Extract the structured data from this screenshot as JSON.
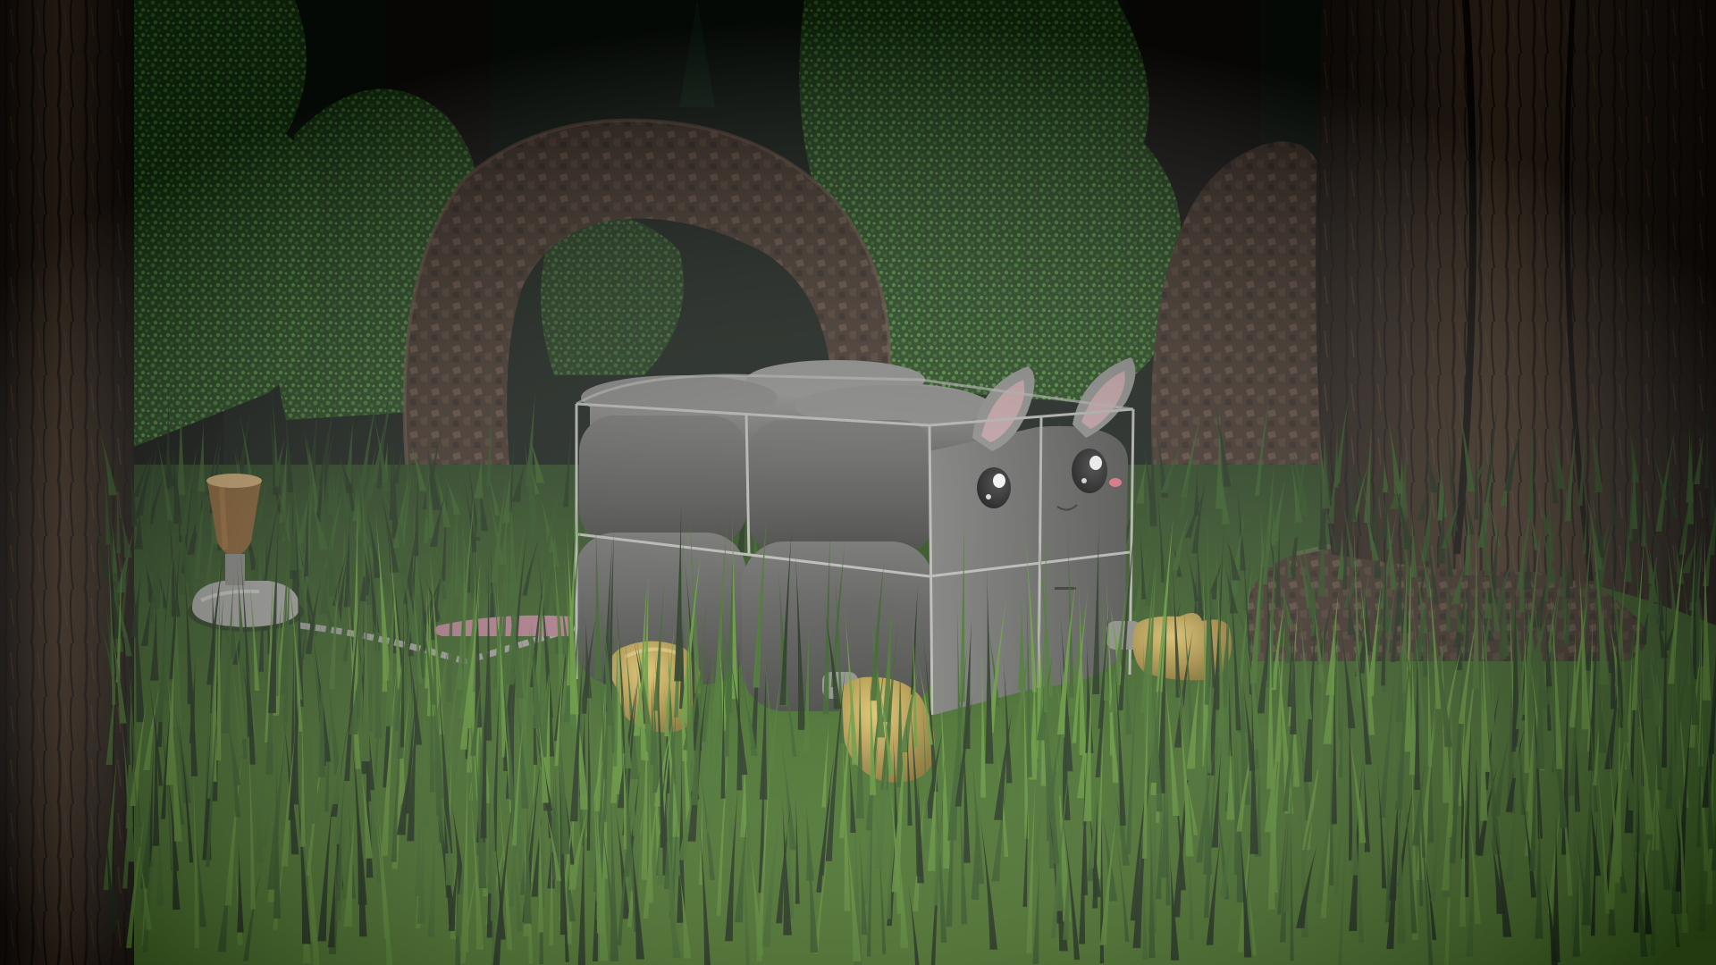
{
  "scene": {
    "colors": {
      "sky_dark": "#0a100c",
      "canopy": "#14200f",
      "bush_light": "#3f8a2e",
      "bush_mid": "#24561c",
      "bush_dark": "#102a0d",
      "rock": "#3a2a20",
      "rock_light": "#6a5040",
      "bark_dark": "#1c140e",
      "bark_mid": "#3b2a1e",
      "bark_light": "#5a4432",
      "grass_dark": "#142810",
      "grass_mid": "#2e5a1c",
      "grass_light": "#5f9a30",
      "ground": "#6f9b2a",
      "cube_light": "#8a8a88",
      "cube_mid": "#5e5e5c",
      "cube_dark": "#323230",
      "cage": "#b8b8b4",
      "ear_inner": "#c8a4a8",
      "cheek": "#e07080",
      "boot": "#b89a3a",
      "boot_light": "#e0c060",
      "tail": "#b07888",
      "chain": "#9a9a96",
      "stake_wood": "#8a5e2a",
      "stake_metal": "#a8a8a4"
    }
  }
}
